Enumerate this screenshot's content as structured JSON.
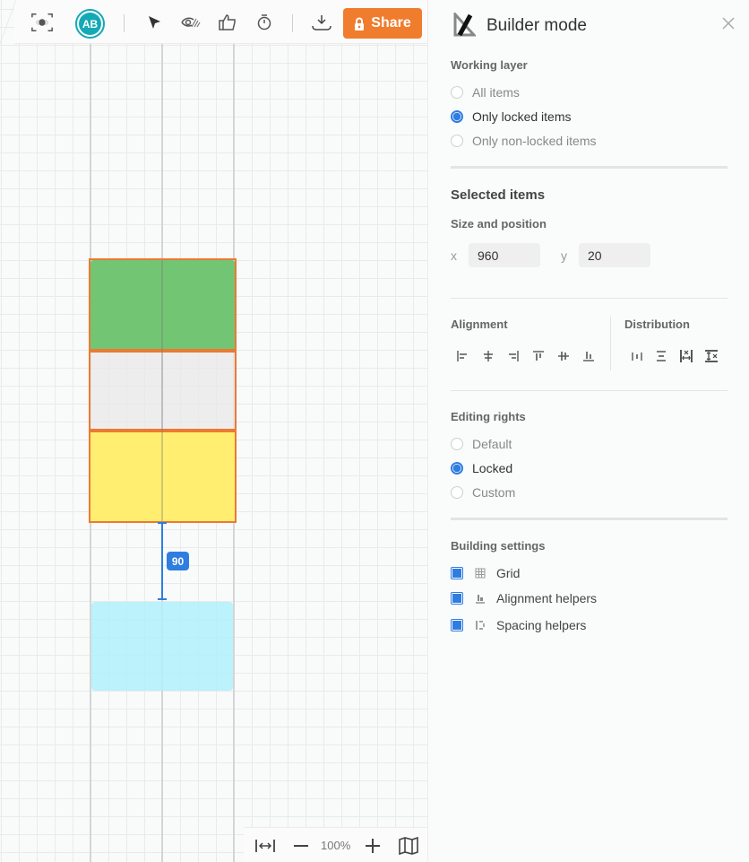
{
  "toolbar": {
    "avatar_initials": "AB",
    "share_label": "Share",
    "icons": [
      "focus-icon",
      "cursor-icon",
      "hide-icon",
      "thumbs-up-icon",
      "timer-icon",
      "download-icon",
      "lock-icon"
    ]
  },
  "canvas": {
    "spacing_value": "90",
    "shapes": [
      {
        "name": "green-shape",
        "color": "#72c573",
        "selected": true
      },
      {
        "name": "grey-shape",
        "color": "#ebebeb",
        "selected": true
      },
      {
        "name": "yellow-shape",
        "color": "#ffee70",
        "selected": true
      },
      {
        "name": "cyan-shape",
        "color": "#b0f0fa",
        "selected": false
      }
    ],
    "selection_color": "#ec7a32",
    "helper_color": "#2f7de1"
  },
  "zoombar": {
    "zoom_level": "100%"
  },
  "panel": {
    "title": "Builder mode",
    "working_layer": {
      "heading": "Working layer",
      "options": [
        {
          "label": "All items",
          "checked": false
        },
        {
          "label": "Only locked items",
          "checked": true
        },
        {
          "label": "Only non-locked items",
          "checked": false
        }
      ]
    },
    "selected_items": {
      "heading": "Selected items",
      "size_position_label": "Size and position",
      "x_label": "x",
      "x_value": "960",
      "y_label": "y",
      "y_value": "20"
    },
    "alignment": {
      "heading": "Alignment",
      "buttons": [
        "align-left",
        "align-center-horizontal",
        "align-right",
        "align-top",
        "align-center-vertical",
        "align-bottom"
      ]
    },
    "distribution": {
      "heading": "Distribution",
      "buttons": [
        "distribute-horizontal",
        "distribute-vertical",
        "tidy-horizontal",
        "tidy-vertical"
      ]
    },
    "editing_rights": {
      "heading": "Editing rights",
      "options": [
        {
          "label": "Default",
          "checked": false
        },
        {
          "label": "Locked",
          "checked": true
        },
        {
          "label": "Custom",
          "checked": false
        }
      ]
    },
    "building_settings": {
      "heading": "Building settings",
      "options": [
        {
          "label": "Grid",
          "checked": true
        },
        {
          "label": "Alignment helpers",
          "checked": true
        },
        {
          "label": "Spacing helpers",
          "checked": true
        }
      ]
    }
  }
}
